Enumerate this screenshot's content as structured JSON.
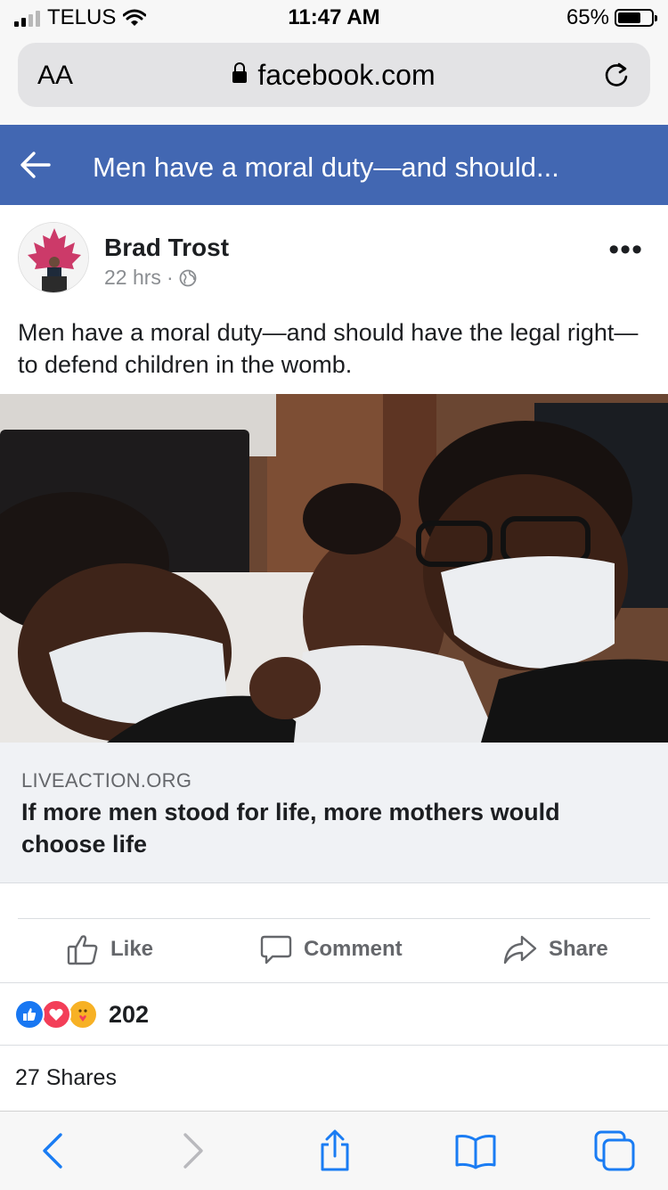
{
  "status_bar": {
    "carrier": "TELUS",
    "time": "11:47 AM",
    "battery": "65%"
  },
  "browser": {
    "text_size_label": "AA",
    "url": "facebook.com"
  },
  "fb_header": {
    "title": "Men have a moral duty—and should..."
  },
  "post": {
    "author": "Brad Trost",
    "time": "22 hrs",
    "separator": "·",
    "text": "Men have a moral duty—and should have the legal right—to defend children in the womb.",
    "link": {
      "domain": "LIVEACTION.ORG",
      "title": "If more men stood for life, more mothers would choose life"
    },
    "actions": {
      "like": "Like",
      "comment": "Comment",
      "share": "Share"
    },
    "reactions_count": "202",
    "shares_text": "27 Shares"
  },
  "colors": {
    "fb_blue": "#4267b2",
    "like_blue": "#1877f2",
    "love_red": "#f33e58",
    "care_yellow": "#f7b125",
    "safari_blue": "#1a7cf3"
  }
}
